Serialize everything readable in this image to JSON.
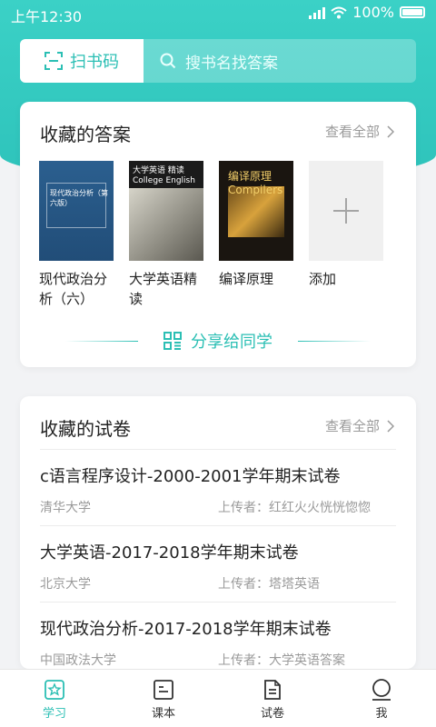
{
  "status_bar": {
    "time": "上午12:30",
    "battery": "100%"
  },
  "search": {
    "scan_label": "扫书码",
    "placeholder": "搜书名找答案"
  },
  "saved_answers": {
    "title": "收藏的答案",
    "view_all": "查看全部",
    "books": [
      {
        "title": "现代政治分析（六）",
        "cover_text": "现代政治分析（第六版）"
      },
      {
        "title": "大学英语精读",
        "cover_text": "大学英语 精读 College English"
      },
      {
        "title": "编译原理",
        "cover_text": "编译原理 Compilers"
      }
    ],
    "add_label": "添加",
    "share_label": "分享给同学"
  },
  "saved_papers": {
    "title": "收藏的试卷",
    "view_all": "查看全部",
    "items": [
      {
        "title": "c语言程序设计-2000-2001学年期末试卷",
        "school": "清华大学",
        "uploader": "上传者：红红火火恍恍惚惚"
      },
      {
        "title": "大学英语-2017-2018学年期末试卷",
        "school": "北京大学",
        "uploader": "上传者：塔塔英语"
      },
      {
        "title": "现代政治分析-2017-2018学年期末试卷",
        "school": "中国政法大学",
        "uploader": "上传者：大学英语答案"
      }
    ]
  },
  "tabs": [
    {
      "label": "学习",
      "icon": "star-icon",
      "active": true
    },
    {
      "label": "课本",
      "icon": "book-icon",
      "active": false
    },
    {
      "label": "试卷",
      "icon": "document-icon",
      "active": false
    },
    {
      "label": "我",
      "icon": "user-icon",
      "active": false
    }
  ],
  "colors": {
    "accent": "#2bbfb4",
    "hero": "#3bd1c6"
  }
}
